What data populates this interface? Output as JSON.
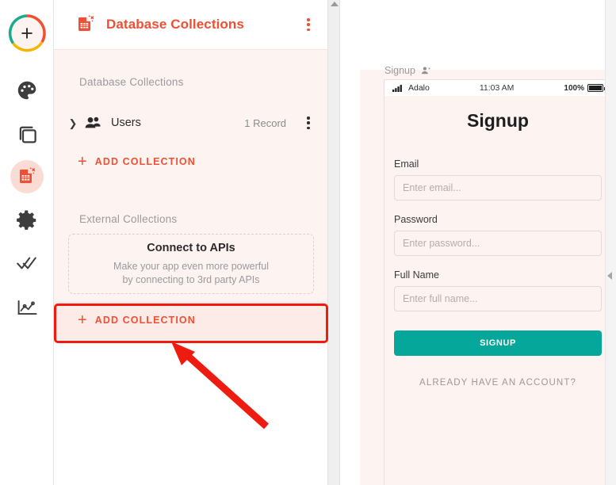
{
  "rail": {
    "items": [
      {
        "name": "add-new",
        "icon": "plus-circle-icon"
      },
      {
        "name": "design",
        "icon": "palette-icon"
      },
      {
        "name": "screens",
        "icon": "screens-icon"
      },
      {
        "name": "database",
        "icon": "database-icon"
      },
      {
        "name": "settings",
        "icon": "gear-icon"
      },
      {
        "name": "publish",
        "icon": "double-check-icon"
      },
      {
        "name": "analytics",
        "icon": "analytics-chart-icon"
      }
    ]
  },
  "panel": {
    "title": "Database Collections",
    "header_icon": "database-icon",
    "menu_icon": "kebab-menu-icon",
    "database_section_label": "Database Collections",
    "collection": {
      "expand_icon": "chevron-right-icon",
      "type_icon": "people-icon",
      "name": "Users",
      "record_count": "1 Record",
      "menu_icon": "kebab-menu-icon"
    },
    "add_collection_top": {
      "plus": "+",
      "label": "ADD COLLECTION"
    },
    "external_section_label": "External Collections",
    "api_card": {
      "title": "Connect to APIs",
      "line1": "Make your app even more powerful",
      "line2": "by connecting to 3rd party APIs"
    },
    "add_collection_bottom": {
      "plus": "+",
      "label": "ADD COLLECTION"
    }
  },
  "canvas": {
    "screen_label": "Signup",
    "screen_label_icon": "user-screen-icon",
    "phone": {
      "status_bar": {
        "signal_icon": "signal-bars-icon",
        "carrier": "Adalo",
        "time": "11:03 AM",
        "battery_percent": "100%",
        "battery_icon": "battery-full-icon"
      },
      "heading": "Signup",
      "fields": [
        {
          "label": "Email",
          "placeholder": "Enter email..."
        },
        {
          "label": "Password",
          "placeholder": "Enter password..."
        },
        {
          "label": "Full Name",
          "placeholder": "Enter full name..."
        }
      ],
      "submit_button": "SIGNUP",
      "secondary_link": "ALREADY HAVE AN ACCOUNT?"
    }
  },
  "annotation": {
    "highlight_target": "add-collection-bottom",
    "box_color": "#f01b0e",
    "arrow_color": "#ee1b10"
  },
  "colors": {
    "brand_orange": "#ef4f34",
    "panel_pink": "#fdf3f1",
    "teal_button": "#04a79a",
    "annotation_red": "#f01b0e"
  }
}
